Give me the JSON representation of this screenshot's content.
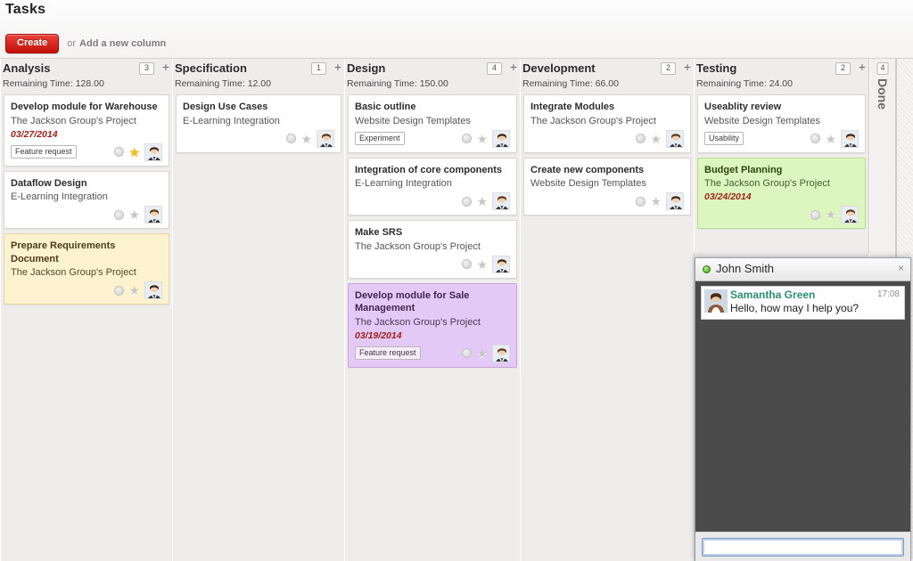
{
  "header": {
    "title": "Tasks",
    "create_label": "Create",
    "or_label": "or",
    "add_column_label": "Add a new column"
  },
  "board": {
    "add_icon": "+",
    "columns": [
      {
        "name": "Analysis",
        "remaining_time": "Remaining Time: 128.00",
        "count": "3",
        "cards": [
          {
            "title": "Develop module for Warehouse",
            "project": "The Jackson Group's Project",
            "date": "03/27/2014",
            "tag": "Feature request",
            "color": "white",
            "starred": true
          },
          {
            "title": "Dataflow Design",
            "project": "E-Learning Integration",
            "date": "",
            "tag": "",
            "color": "white",
            "starred": false
          },
          {
            "title": "Prepare Requirements Document",
            "project": "The Jackson Group's Project",
            "date": "",
            "tag": "",
            "color": "yellow",
            "starred": false
          }
        ]
      },
      {
        "name": "Specification",
        "remaining_time": "Remaining Time: 12.00",
        "count": "1",
        "cards": [
          {
            "title": "Design Use Cases",
            "project": "E-Learning Integration",
            "date": "",
            "tag": "",
            "color": "white",
            "starred": false
          }
        ]
      },
      {
        "name": "Design",
        "remaining_time": "Remaining Time: 150.00",
        "count": "4",
        "cards": [
          {
            "title": "Basic outline",
            "project": "Website Design Templates",
            "date": "",
            "tag": "Experiment",
            "color": "white",
            "starred": false
          },
          {
            "title": "Integration of core components",
            "project": "E-Learning Integration",
            "date": "",
            "tag": "",
            "color": "white",
            "starred": false
          },
          {
            "title": "Make SRS",
            "project": "The Jackson Group's Project",
            "date": "",
            "tag": "",
            "color": "white",
            "starred": false
          },
          {
            "title": "Develop module for Sale Management",
            "project": "The Jackson Group's Project",
            "date": "03/19/2014",
            "tag": "Feature request",
            "color": "purple",
            "starred": false
          }
        ]
      },
      {
        "name": "Development",
        "remaining_time": "Remaining Time: 66.00",
        "count": "2",
        "cards": [
          {
            "title": "Integrate Modules",
            "project": "The Jackson Group's Project",
            "date": "",
            "tag": "",
            "color": "white",
            "starred": false
          },
          {
            "title": "Create new components",
            "project": "Website Design Templates",
            "date": "",
            "tag": "",
            "color": "white",
            "starred": false
          }
        ]
      },
      {
        "name": "Testing",
        "remaining_time": "Remaining Time: 24.00",
        "count": "2",
        "cards": [
          {
            "title": "Useablity review",
            "project": "Website Design Templates",
            "date": "",
            "tag": "Usability",
            "color": "white",
            "starred": false
          },
          {
            "title": "Budget Planning",
            "project": "The Jackson Group's Project",
            "date": "03/24/2014",
            "tag": "",
            "color": "green",
            "starred": false
          }
        ]
      }
    ],
    "done_column": {
      "name": "Done",
      "count": "4"
    }
  },
  "chat": {
    "contact_name": "John Smith",
    "status": "online",
    "close_label": "×",
    "messages": [
      {
        "sender": "Samantha Green",
        "time": "17:08",
        "text": "Hello, how may I help you?"
      }
    ],
    "input_value": "",
    "input_placeholder": ""
  },
  "colors": {
    "accent_red": "#c5100a",
    "card_yellow": "#fdf2cf",
    "card_purple": "#e3c9f5",
    "card_green": "#ddf6c0",
    "board_bg": "#efedec",
    "star_on": "#f3c111",
    "chat_sender": "#2d8f6f",
    "status_online": "#3f9c16"
  }
}
